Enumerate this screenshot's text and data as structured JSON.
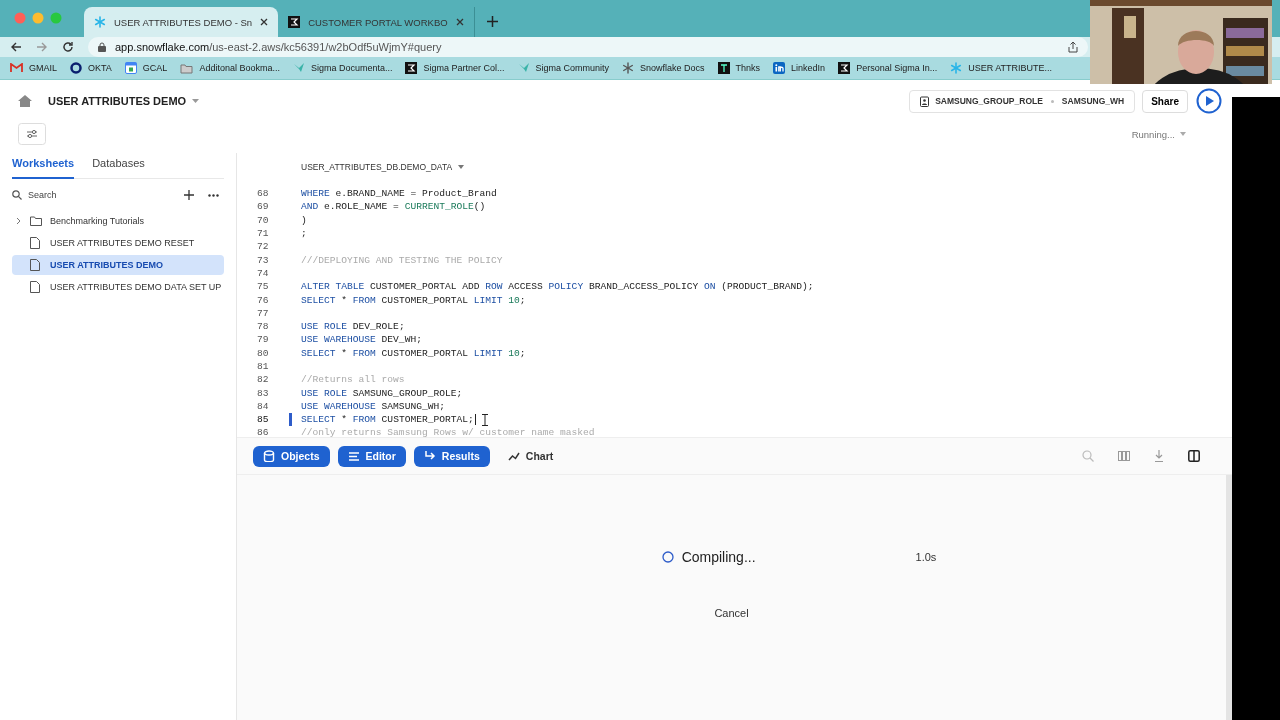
{
  "browser": {
    "tabs": [
      {
        "title": "USER ATTRIBUTES DEMO - Sn",
        "kind": "snowflake",
        "selected": true
      },
      {
        "title": "CUSTOMER PORTAL WORKBO",
        "kind": "sigma",
        "selected": false
      }
    ],
    "url_host": "app.snowflake.com",
    "url_path": "/us-east-2.aws/kc56391/w2bOdf5uWjmY#query",
    "bookmarks": [
      {
        "label": "GMAIL",
        "kind": "mail"
      },
      {
        "label": "OKTA",
        "kind": "ring"
      },
      {
        "label": "GCAL",
        "kind": "calendar"
      },
      {
        "label": "Additonal Bookma...",
        "kind": "folder"
      },
      {
        "label": "Sigma Documenta...",
        "kind": "bird"
      },
      {
        "label": "Sigma Partner Col...",
        "kind": "sigma"
      },
      {
        "label": "Sigma Community",
        "kind": "bird"
      },
      {
        "label": "Snowflake Docs",
        "kind": "gear"
      },
      {
        "label": "Thnks",
        "kind": "letter"
      },
      {
        "label": "LinkedIn",
        "kind": "linkedin"
      },
      {
        "label": "Personal Sigma In...",
        "kind": "sigma"
      },
      {
        "label": "USER ATTRIBUTE...",
        "kind": "snowflake"
      }
    ]
  },
  "header": {
    "title": "USER ATTRIBUTES DEMO",
    "role": "SAMSUNG_GROUP_ROLE",
    "warehouse": "SAMSUNG_WH",
    "share": "Share",
    "status": "Running..."
  },
  "sidebar": {
    "tabs": [
      {
        "label": "Worksheets",
        "selected": true
      },
      {
        "label": "Databases",
        "selected": false
      }
    ],
    "search": {
      "placeholder": "Search"
    },
    "items": [
      {
        "label": "Benchmarking Tutorials",
        "kind": "folder",
        "expanded": false,
        "selected": false
      },
      {
        "label": "USER ATTRIBUTES DEMO RESET",
        "kind": "file",
        "selected": false
      },
      {
        "label": "USER ATTRIBUTES DEMO",
        "kind": "file",
        "selected": true
      },
      {
        "label": "USER ATTRIBUTES DEMO DATA SET UP",
        "kind": "file",
        "selected": false
      }
    ]
  },
  "editor": {
    "context": "USER_ATTRIBUTES_DB.DEMO_DATA",
    "lines": [
      {
        "number": "68",
        "active": false,
        "tokens": [
          {
            "text": "WHERE",
            "kind": "kw"
          },
          {
            "text": " e.BRAND_NAME = Product_Brand",
            "kind": "plain"
          }
        ]
      },
      {
        "number": "69",
        "active": false,
        "tokens": [
          {
            "text": "AND",
            "kind": "kw"
          },
          {
            "text": " e.ROLE_NAME = ",
            "kind": "plain"
          },
          {
            "text": "CURRENT_ROLE",
            "kind": "fn"
          },
          {
            "text": "()",
            "kind": "plain"
          }
        ]
      },
      {
        "number": "70",
        "active": false,
        "tokens": [
          {
            "text": ")",
            "kind": "plain"
          }
        ]
      },
      {
        "number": "71",
        "active": false,
        "tokens": [
          {
            "text": ";",
            "kind": "plain"
          }
        ]
      },
      {
        "number": "72",
        "active": false
      },
      {
        "number": "73",
        "active": false,
        "tokens": [
          {
            "text": "///DEPLOYING AND TESTING THE POLICY",
            "kind": "comment"
          }
        ]
      },
      {
        "number": "74",
        "active": false
      },
      {
        "number": "75",
        "active": false,
        "tokens": [
          {
            "text": "ALTER TABLE",
            "kind": "kw"
          },
          {
            "text": " CUSTOMER_PORTAL ADD ",
            "kind": "plain"
          },
          {
            "text": "ROW",
            "kind": "kw"
          },
          {
            "text": " ACCESS ",
            "kind": "plain"
          },
          {
            "text": "POLICY",
            "kind": "kw"
          },
          {
            "text": " BRAND_ACCESS_POLICY ",
            "kind": "plain"
          },
          {
            "text": "ON",
            "kind": "kw"
          },
          {
            "text": " (PRODUCT_BRAND);",
            "kind": "plain"
          }
        ]
      },
      {
        "number": "76",
        "active": false,
        "tokens": [
          {
            "text": "SELECT",
            "kind": "kw"
          },
          {
            "text": " * ",
            "kind": "plain"
          },
          {
            "text": "FROM",
            "kind": "kw"
          },
          {
            "text": " CUSTOMER_PORTAL ",
            "kind": "plain"
          },
          {
            "text": "LIMIT",
            "kind": "kw"
          },
          {
            "text": " 10",
            "kind": "num"
          },
          {
            "text": ";",
            "kind": "plain"
          }
        ]
      },
      {
        "number": "77",
        "active": false
      },
      {
        "number": "78",
        "active": false,
        "tokens": [
          {
            "text": "USE ROLE",
            "kind": "kw"
          },
          {
            "text": " DEV_ROLE;",
            "kind": "plain"
          }
        ]
      },
      {
        "number": "79",
        "active": false,
        "tokens": [
          {
            "text": "USE WAREHOUSE",
            "kind": "kw"
          },
          {
            "text": " DEV_WH;",
            "kind": "plain"
          }
        ]
      },
      {
        "number": "80",
        "active": false,
        "tokens": [
          {
            "text": "SELECT",
            "kind": "kw"
          },
          {
            "text": " * ",
            "kind": "plain"
          },
          {
            "text": "FROM",
            "kind": "kw"
          },
          {
            "text": " CUSTOMER_PORTAL ",
            "kind": "plain"
          },
          {
            "text": "LIMIT",
            "kind": "kw"
          },
          {
            "text": " 10",
            "kind": "num"
          },
          {
            "text": ";",
            "kind": "plain"
          }
        ]
      },
      {
        "number": "81",
        "active": false
      },
      {
        "number": "82",
        "active": false,
        "tokens": [
          {
            "text": "//Returns all rows",
            "kind": "comment"
          }
        ]
      },
      {
        "number": "83",
        "active": false,
        "tokens": [
          {
            "text": "USE ROLE",
            "kind": "kw"
          },
          {
            "text": " SAMSUNG_GROUP_ROLE;",
            "kind": "plain"
          }
        ]
      },
      {
        "number": "84",
        "active": false,
        "tokens": [
          {
            "text": "USE WAREHOUSE",
            "kind": "kw"
          },
          {
            "text": " SAMSUNG_WH;",
            "kind": "plain"
          }
        ]
      },
      {
        "number": "85",
        "active": true,
        "tokens": [
          {
            "text": "SELECT",
            "kind": "kw"
          },
          {
            "text": " * ",
            "kind": "plain"
          },
          {
            "text": "FROM",
            "kind": "kw"
          },
          {
            "text": " CUSTOMER_PORTAL;",
            "kind": "plain"
          }
        ]
      },
      {
        "number": "86",
        "active": false,
        "tokens": [
          {
            "text": "//only returns Samsung Rows w/ customer name masked",
            "kind": "comment"
          }
        ]
      }
    ]
  },
  "panel_tabs": [
    {
      "label": "Objects",
      "kind": "db",
      "on": true
    },
    {
      "label": "Editor",
      "kind": "lines",
      "on": true
    },
    {
      "label": "Results",
      "kind": "arrow",
      "on": true
    },
    {
      "label": "Chart",
      "kind": "chart",
      "on": false
    }
  ],
  "results": {
    "status": "Compiling...",
    "elapsed": "1.0s",
    "cancel": "Cancel"
  }
}
